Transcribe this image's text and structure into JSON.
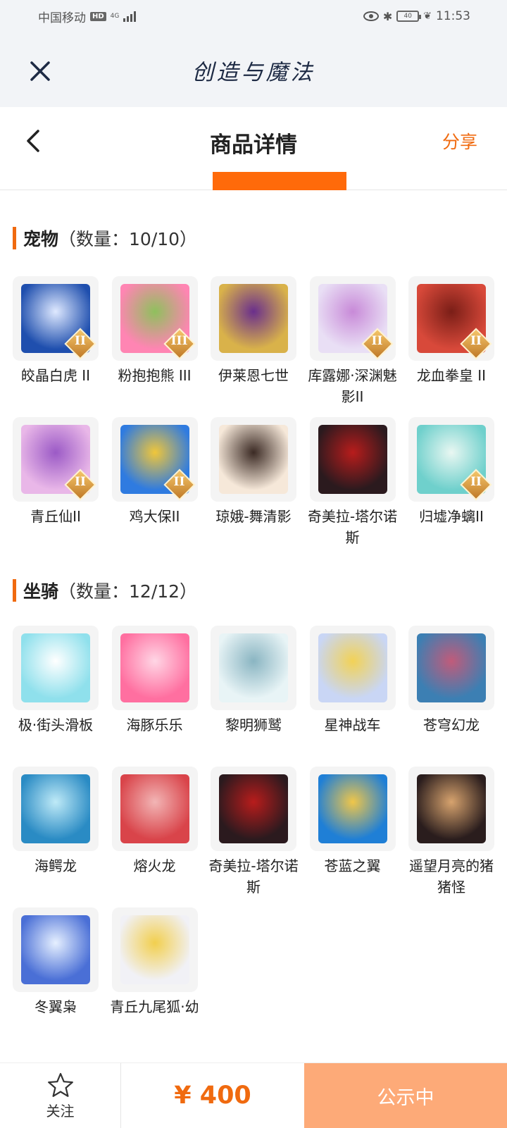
{
  "status_bar": {
    "carrier": "中国移动",
    "hd": "HD",
    "network": "4G",
    "battery": "40",
    "time": "11:53"
  },
  "app": {
    "title": "创造与魔法"
  },
  "nav": {
    "title": "商品详情",
    "share_label": "分享"
  },
  "pets": {
    "title": "宠物",
    "count": "（数量：10/10）",
    "items": [
      {
        "name": "皎晶白虎 II",
        "badge": "II",
        "colors": [
          "#1f4fae",
          "#dfe9ff"
        ]
      },
      {
        "name": "粉抱抱熊 III",
        "badge": "III",
        "colors": [
          "#ff85b3",
          "#8fc05d"
        ]
      },
      {
        "name": "伊莱恩七世",
        "badge": "",
        "colors": [
          "#d9b24a",
          "#6a2f8c"
        ]
      },
      {
        "name": "库露娜·深渊魅影II",
        "badge": "II",
        "colors": [
          "#e9dff5",
          "#c88ad8"
        ]
      },
      {
        "name": "龙血拳皇 II",
        "badge": "II",
        "colors": [
          "#d8493a",
          "#7a1e17"
        ]
      },
      {
        "name": "青丘仙II",
        "badge": "II",
        "colors": [
          "#e9b7e8",
          "#9b5ac6"
        ]
      },
      {
        "name": "鸡大保II",
        "badge": "II",
        "colors": [
          "#2f7be0",
          "#f0c63a"
        ]
      },
      {
        "name": "琼娥-舞清影",
        "badge": "",
        "colors": [
          "#f6e8d9",
          "#3b2a24"
        ]
      },
      {
        "name": "奇美拉-塔尔诺斯",
        "badge": "",
        "colors": [
          "#2b1a1e",
          "#b81c1c"
        ]
      },
      {
        "name": "归墟净螭II",
        "badge": "II",
        "colors": [
          "#6fd0cc",
          "#e9f7f2"
        ]
      }
    ]
  },
  "mounts": {
    "title": "坐骑",
    "count": "（数量：12/12）",
    "items": [
      {
        "name": "极·街头滑板",
        "badge": "",
        "colors": [
          "#8fe0ec",
          "#ffffff"
        ]
      },
      {
        "name": "海豚乐乐",
        "badge": "",
        "colors": [
          "#ff6fa0",
          "#ffd6e5"
        ]
      },
      {
        "name": "黎明狮鹫",
        "badge": "",
        "colors": [
          "#e8f4f6",
          "#8ab5c2"
        ]
      },
      {
        "name": "星神战车",
        "badge": "",
        "colors": [
          "#c9d6f5",
          "#f2d256"
        ]
      },
      {
        "name": "苍穹幻龙",
        "badge": "",
        "colors": [
          "#3c7fb3",
          "#c15b7a"
        ]
      },
      {
        "name": "海鳄龙",
        "badge": "",
        "colors": [
          "#2a8bc4",
          "#bfeaf7"
        ]
      },
      {
        "name": "熔火龙",
        "badge": "",
        "colors": [
          "#d9444a",
          "#f2b5b5"
        ]
      },
      {
        "name": "奇美拉-塔尔诺斯",
        "badge": "",
        "colors": [
          "#2b1a1e",
          "#b81c1c"
        ]
      },
      {
        "name": "苍蓝之翼",
        "badge": "",
        "colors": [
          "#1f7fd6",
          "#f0c649"
        ]
      },
      {
        "name": "遥望月亮的猪猪怪",
        "badge": "",
        "colors": [
          "#2a1d1d",
          "#d7a36e"
        ]
      },
      {
        "name": "冬翼枭",
        "badge": "",
        "colors": [
          "#4a6fd6",
          "#e6f0ff"
        ]
      },
      {
        "name": "青丘九尾狐·幼",
        "badge": "",
        "colors": [
          "#f1f1f6",
          "#f2cf4e"
        ]
      }
    ]
  },
  "bottom": {
    "follow_label": "关注",
    "price": "¥ 400",
    "status_label": "公示中"
  },
  "colors": {
    "accent": "#f06a0f",
    "button_bg": "#fdaa78",
    "header_bg": "#f2f4f7"
  }
}
